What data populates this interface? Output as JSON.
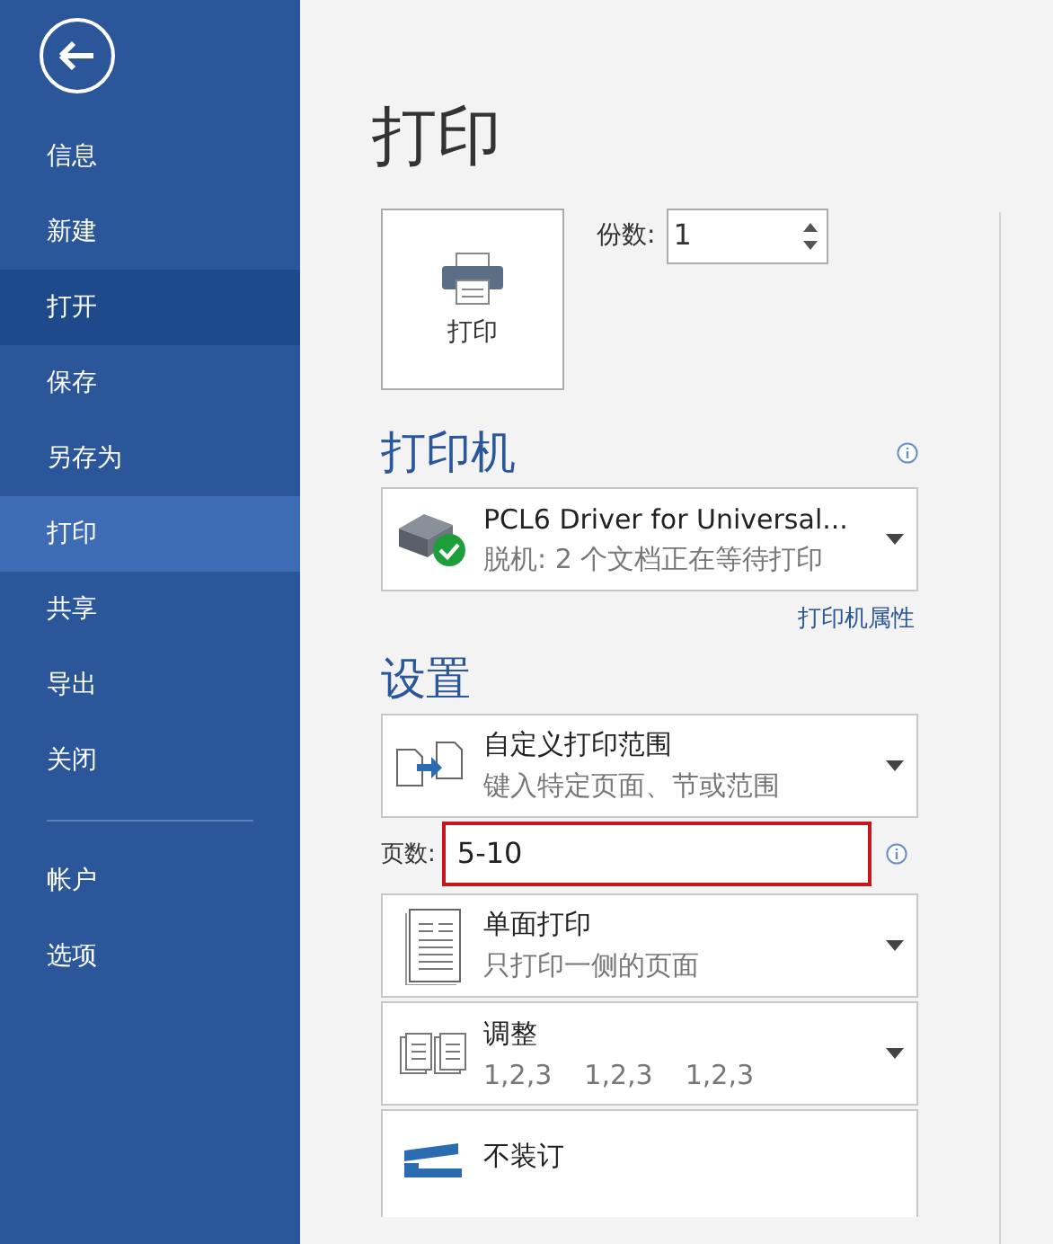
{
  "sidebar": {
    "items": [
      {
        "label": "信息",
        "selected": false,
        "highlighted": false
      },
      {
        "label": "新建",
        "selected": false,
        "highlighted": false
      },
      {
        "label": "打开",
        "selected": false,
        "highlighted": true
      },
      {
        "label": "保存",
        "selected": false,
        "highlighted": false
      },
      {
        "label": "另存为",
        "selected": false,
        "highlighted": false
      },
      {
        "label": "打印",
        "selected": true,
        "highlighted": false
      },
      {
        "label": "共享",
        "selected": false,
        "highlighted": false
      },
      {
        "label": "导出",
        "selected": false,
        "highlighted": false
      },
      {
        "label": "关闭",
        "selected": false,
        "highlighted": false
      }
    ],
    "footer_items": [
      {
        "label": "帐户"
      },
      {
        "label": "选项"
      }
    ]
  },
  "title": "打印",
  "print_button": {
    "label": "打印"
  },
  "copies": {
    "label": "份数:",
    "value": "1"
  },
  "printer": {
    "heading": "打印机",
    "name": "PCL6 Driver for Universal...",
    "status": "脱机: 2 个文档正在等待打印",
    "properties_link": "打印机属性"
  },
  "settings": {
    "heading": "设置",
    "options": [
      {
        "kind": "range",
        "title": "自定义打印范围",
        "subtitle": "键入特定页面、节或范围"
      },
      {
        "kind": "sides",
        "title": "单面打印",
        "subtitle": "只打印一侧的页面"
      },
      {
        "kind": "collate",
        "title": "调整",
        "subtitle_parts": [
          "1,2,3",
          "1,2,3",
          "1,2,3"
        ]
      },
      {
        "kind": "staple",
        "title": "不装订"
      }
    ],
    "pages": {
      "label": "页数:",
      "value": "5-10",
      "highlighted": true
    }
  }
}
